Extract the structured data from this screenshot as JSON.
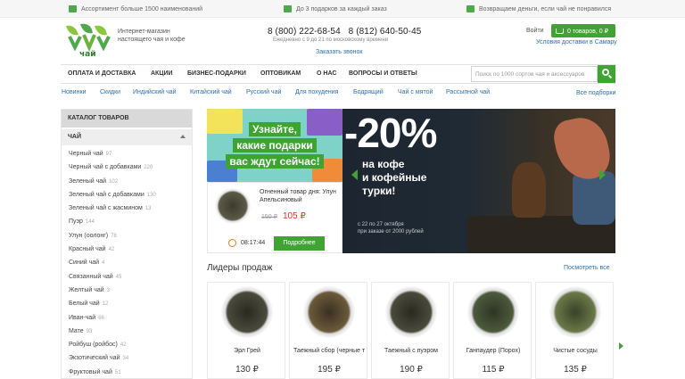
{
  "topbar": {
    "items": [
      {
        "text": "Ассортимент больше 1500 наименований",
        "icon": "cup-icon"
      },
      {
        "text": "До 3 подарков за каждый заказ",
        "icon": "gift-icon"
      },
      {
        "text": "Возвращаем деньги, если чай не понравился",
        "icon": "wallet-icon"
      }
    ]
  },
  "header": {
    "logo_text": "чай",
    "tagline_line1": "Интернет-магазин",
    "tagline_line2": "настоящего чая и кофе",
    "phone1": "8 (800) 222-68-54",
    "phone2": "8 (812) 640-50-45",
    "hours": "Ежедневно с 9 до 21 по московскому времени",
    "callback": "Заказать звонок",
    "login": "Войти",
    "cart": "0 товаров, 0 ₽",
    "delivery": "Условия доставки в Самару"
  },
  "nav": {
    "items": [
      "ОПЛАТА И ДОСТАВКА",
      "АКЦИИ",
      "БИЗНЕС-ПОДАРКИ",
      "ОПТОВИКАМ",
      "О НАС",
      "ВОПРОСЫ И ОТВЕТЫ"
    ],
    "search_placeholder": "Поиск по 1000 сортов чая и аксессуаров"
  },
  "tags": {
    "items": [
      "Новинки",
      "Скидки",
      "Индийский чай",
      "Китайский чай",
      "Русский чай",
      "Для похудения",
      "Бодрящий",
      "Чай с мятой",
      "Рассыпной чай"
    ],
    "all": "Все подборки"
  },
  "sidebar": {
    "title": "КАТАЛОГ ТОВАРОВ",
    "section": "ЧАЙ",
    "items": [
      {
        "name": "Черный чай",
        "count": "97"
      },
      {
        "name": "Черный чай с добавками",
        "count": "220"
      },
      {
        "name": "Зеленый чай",
        "count": "102"
      },
      {
        "name": "Зеленый чай с добавками",
        "count": "130"
      },
      {
        "name": "Зеленый чай с жасмином",
        "count": "13"
      },
      {
        "name": "Пуэр",
        "count": "144"
      },
      {
        "name": "Улун (оолонг)",
        "count": "78"
      },
      {
        "name": "Красный чай",
        "count": "42"
      },
      {
        "name": "Синий чай",
        "count": "4"
      },
      {
        "name": "Связанный чай",
        "count": "45"
      },
      {
        "name": "Желтый чай",
        "count": "3"
      },
      {
        "name": "Белый чай",
        "count": "12"
      },
      {
        "name": "Иван-чай",
        "count": "66"
      },
      {
        "name": "Мате",
        "count": "93"
      },
      {
        "name": "Ройбуш (ройбос)",
        "count": "42"
      },
      {
        "name": "Экзотический чай",
        "count": "34"
      },
      {
        "name": "Фруктовый чай",
        "count": "51"
      }
    ]
  },
  "promo": {
    "line1": "Узнайте,",
    "line2": "какие подарки",
    "line3": "вас ждут сейчас!"
  },
  "hot": {
    "title": "Огненный товар дня: Улун Апельсиновый",
    "old_price": "150 ₽",
    "new_price": "105 ₽",
    "timer": "08:17:44",
    "button": "Подробнее"
  },
  "banner": {
    "discount": "-20%",
    "sub1": "на кофе",
    "sub2": "и кофейные",
    "sub3": "турки!",
    "date_line1": "с 22 по 27 октября",
    "date_line2": "при заказе от 2000 рублей"
  },
  "leaders": {
    "title": "Лидеры продаж",
    "see_all": "Посмотреть все",
    "products": [
      {
        "name": "Эрл Грей",
        "price": "130 ₽"
      },
      {
        "name": "Таежный сбор (черные типсы)",
        "price": "195 ₽"
      },
      {
        "name": "Таежный с пуэром",
        "price": "190 ₽"
      },
      {
        "name": "Ганпаудер (Порох)",
        "price": "115 ₽"
      },
      {
        "name": "Чистые сосуды",
        "price": "135 ₽"
      }
    ]
  },
  "colors": {
    "brand_green": "#41a334",
    "link_blue": "#2d6fb1",
    "price_red": "#d9381e"
  }
}
